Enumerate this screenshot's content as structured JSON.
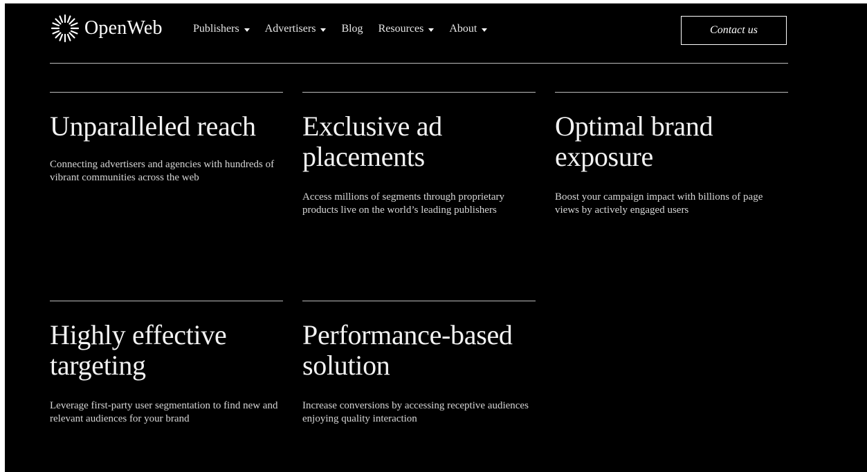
{
  "header": {
    "logo_text": "OpenWeb",
    "logo_icon": "starburst-icon",
    "nav": [
      {
        "label": "Publishers",
        "has_dropdown": true
      },
      {
        "label": "Advertisers",
        "has_dropdown": true
      },
      {
        "label": "Blog",
        "has_dropdown": false
      },
      {
        "label": "Resources",
        "has_dropdown": true
      },
      {
        "label": "About",
        "has_dropdown": true
      }
    ],
    "contact_label": "Contact us"
  },
  "features": [
    {
      "title": "Unparalleled reach",
      "description": "Connecting advertisers and agencies with hundreds of vibrant communities across the web"
    },
    {
      "title": "Exclusive ad placements",
      "description": "Access millions of segments through proprietary products live on the world’s leading publishers"
    },
    {
      "title": "Optimal brand exposure",
      "description": "Boost your campaign impact with billions of page views by actively engaged users"
    },
    {
      "title": "Highly effective targeting",
      "description": "Leverage first-party user segmentation to find new and relevant audiences for your brand"
    },
    {
      "title": "Performance-based solution",
      "description": "Increase conversions by accessing receptive audiences enjoying quality interaction"
    }
  ],
  "colors": {
    "background": "#000000",
    "text": "#ffffff",
    "divider": "#bdbdbd"
  }
}
